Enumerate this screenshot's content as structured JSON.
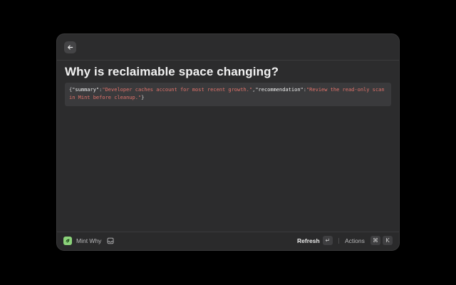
{
  "header": {
    "back_icon": "arrow-left-icon"
  },
  "main": {
    "title": "Why is reclaimable space changing?",
    "json_output": {
      "open": "{",
      "summary_key": "\"summary\"",
      "colon1": ":",
      "summary_value": "\"Developer caches account for most recent growth.\"",
      "comma": ",",
      "recommendation_key": "\"recommendation\"",
      "colon2": ":",
      "recommendation_value": "\"Review the read-only scan in Mint before cleanup.\"",
      "close": "}"
    }
  },
  "footer": {
    "app_name": "Mint Why",
    "app_icon": "mint-app-icon",
    "tray_icon": "inbox-tray-icon",
    "primary_action": "Refresh",
    "primary_shortcut": "↵",
    "actions_label": "Actions",
    "actions_shortcut_mod": "⌘",
    "actions_shortcut_key": "K"
  },
  "colors": {
    "window_bg": "#2c2c2d",
    "code_bg": "#3a3a3c",
    "string_color": "#e2736b",
    "accent_green": "#8bd37a"
  }
}
